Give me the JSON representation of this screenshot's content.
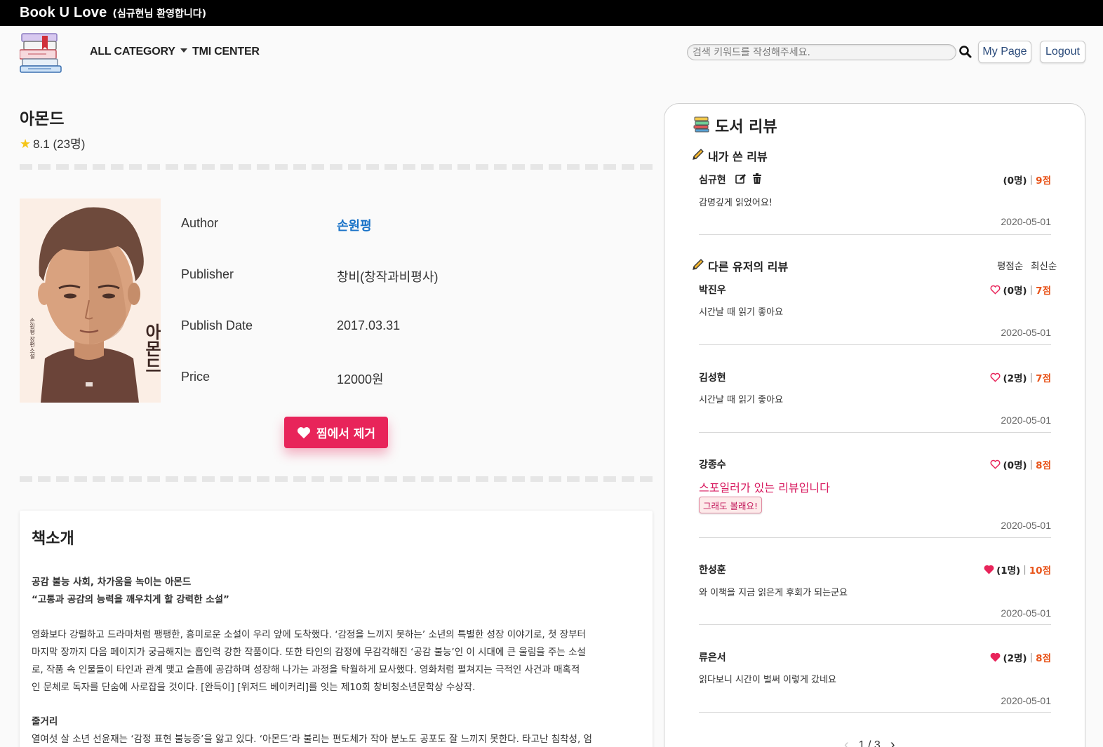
{
  "topbar": {
    "brand": "Book U Love",
    "welcome": "(심규현님 환영합니다)"
  },
  "nav": {
    "category": "ALL CATEGORY",
    "tmi": "TMI CENTER",
    "search_placeholder": "검색 키워드를 작성해주세요.",
    "mypage": "My Page",
    "logout": "Logout"
  },
  "book": {
    "title": "아몬드",
    "rating": "8.1 (23명)",
    "labels": {
      "author": "Author",
      "publisher": "Publisher",
      "date": "Publish Date",
      "price": "Price"
    },
    "author": "손원평",
    "publisher": "창비(창작과비평사)",
    "publish_date": "2017.03.31",
    "price": "12000원",
    "wish_button": "찜에서 제거",
    "cover_title": "아몬드",
    "cover_subtitle": "손원평 장편소설"
  },
  "intro": {
    "title": "책소개",
    "headline1": "공감 불능 사회, 차가움을 녹이는 아몬드",
    "headline2": "“고통과 공감의 능력을 깨우치게 할 강력한 소설”",
    "p1_l1": "영화보다 강렬하고 드라마처럼 팽팽한, 흥미로운 소설이 우리 앞에 도착했다. ‘감정을 느끼지 못하는’ 소년의 특별한 성장 이야기로, 첫 장부터",
    "p1_l2": "마지막 장까지 다음 페이지가 궁금해지는 흡인력 강한 작품이다. 또한 타인의 감정에 무감각해진 ‘공감 불능’인 이 시대에 큰 울림을 주는 소설",
    "p1_l3": "로, 작품 속 인물들이 타인과 관계 맺고 슬픔에 공감하며 성장해 나가는 과정을 탁월하게 묘사했다. 영화처럼 펼쳐지는 극적인 사건과 매혹적",
    "p1_l4": "인 문체로 독자를 단숨에 사로잡을 것이다. [완득이] [위저드 베이커리]를 잇는 제10회 창비청소년문학상 수상작.",
    "plot_title": "줄거리",
    "plot_l1": "열여섯 살 소년 선윤재는 ‘감정 표현 불능증’을 앓고 있다. ‘아몬드’라 불리는 편도체가 작아 분노도 공포도 잘 느끼지 못한다. 타고난 침착성, 엄"
  },
  "reviews": {
    "title": "도서 리뷰",
    "my_section": "내가 쓴 리뷰",
    "other_section": "다른 유저의 리뷰",
    "sort_rating": "평점순",
    "sort_latest": "최신순",
    "my": {
      "name": "심규현",
      "likes": "(0명)",
      "score": "9점",
      "text": "감명깊게 읽었어요!",
      "date": "2020-05-01"
    },
    "others": [
      {
        "name": "박진우",
        "likes": "(0명)",
        "score": "7점",
        "text": "시간날 때 읽기 좋아요",
        "date": "2020-05-01",
        "liked": false
      },
      {
        "name": "김성현",
        "likes": "(2명)",
        "score": "7점",
        "text": "시간날 때 읽기 좋아요",
        "date": "2020-05-01",
        "liked": false
      },
      {
        "name": "강종수",
        "likes": "(0명)",
        "score": "8점",
        "spoiler": "스포일러가 있는 리뷰입니다",
        "spoiler_button": "그래도 볼래요!",
        "date": "2020-05-01",
        "liked": false
      },
      {
        "name": "한성훈",
        "likes": "(1명)",
        "score": "10점",
        "text": "와 이책을 지금 읽은게 후회가 되는군요",
        "date": "2020-05-01",
        "liked": true
      },
      {
        "name": "류은서",
        "likes": "(2명)",
        "score": "8점",
        "text": "읽다보니 시간이 벌써 이렇게 갔네요",
        "date": "2020-05-01",
        "liked": true
      }
    ],
    "separator": "|",
    "pager": "1 / 3"
  },
  "colors": {
    "accent": "#e8245a",
    "score": "#e8541a",
    "link": "#1a73c8",
    "spoiler": "#d81b60"
  }
}
